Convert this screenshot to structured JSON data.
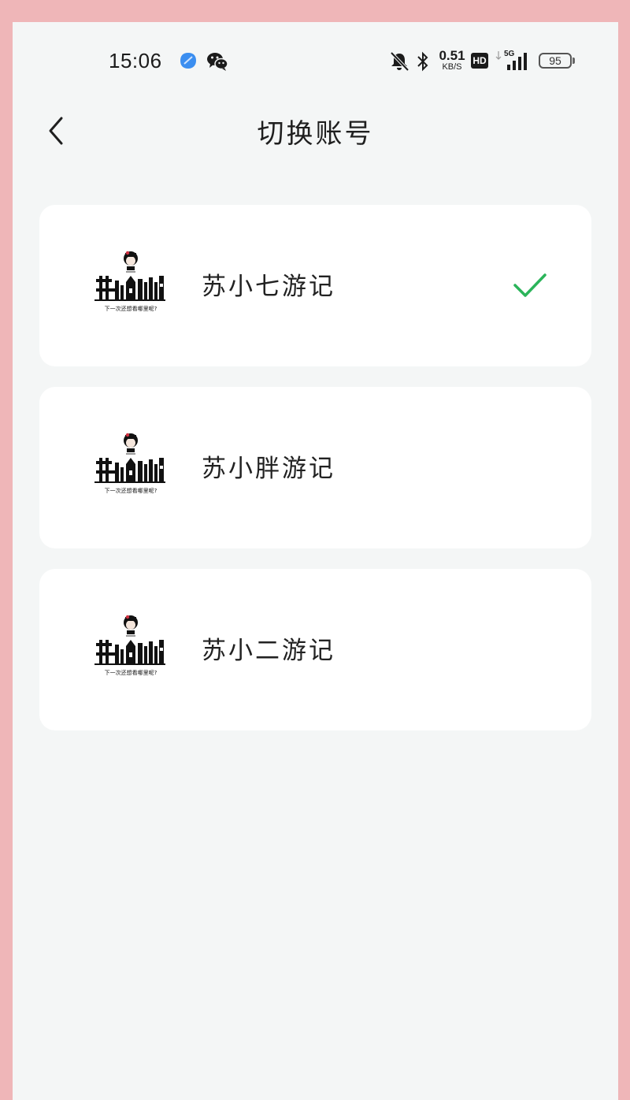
{
  "status_bar": {
    "time": "15:06",
    "net_speed_value": "0.51",
    "net_speed_unit": "KB/S",
    "hd_label": "HD",
    "network_type": "5G",
    "battery_level": "95",
    "icons": [
      "app-notification-icon",
      "wechat-icon",
      "mute-bell-icon",
      "bluetooth-icon",
      "signal-icon",
      "battery-icon"
    ]
  },
  "header": {
    "title": "切换账号",
    "back_icon": "chevron-left-icon"
  },
  "accounts": [
    {
      "name": "苏小七游记",
      "selected": true,
      "logo_caption": "下一次还想看哪里呢?"
    },
    {
      "name": "苏小胖游记",
      "selected": false,
      "logo_caption": "下一次还想看哪里呢?"
    },
    {
      "name": "苏小二游记",
      "selected": false,
      "logo_caption": "下一次还想看哪里呢?"
    }
  ],
  "colors": {
    "outer_background": "#efb6b8",
    "screen_background": "#f4f6f6",
    "card_background": "#ffffff",
    "check_green": "#2bb45a",
    "notification_blue": "#3b8ef0"
  }
}
